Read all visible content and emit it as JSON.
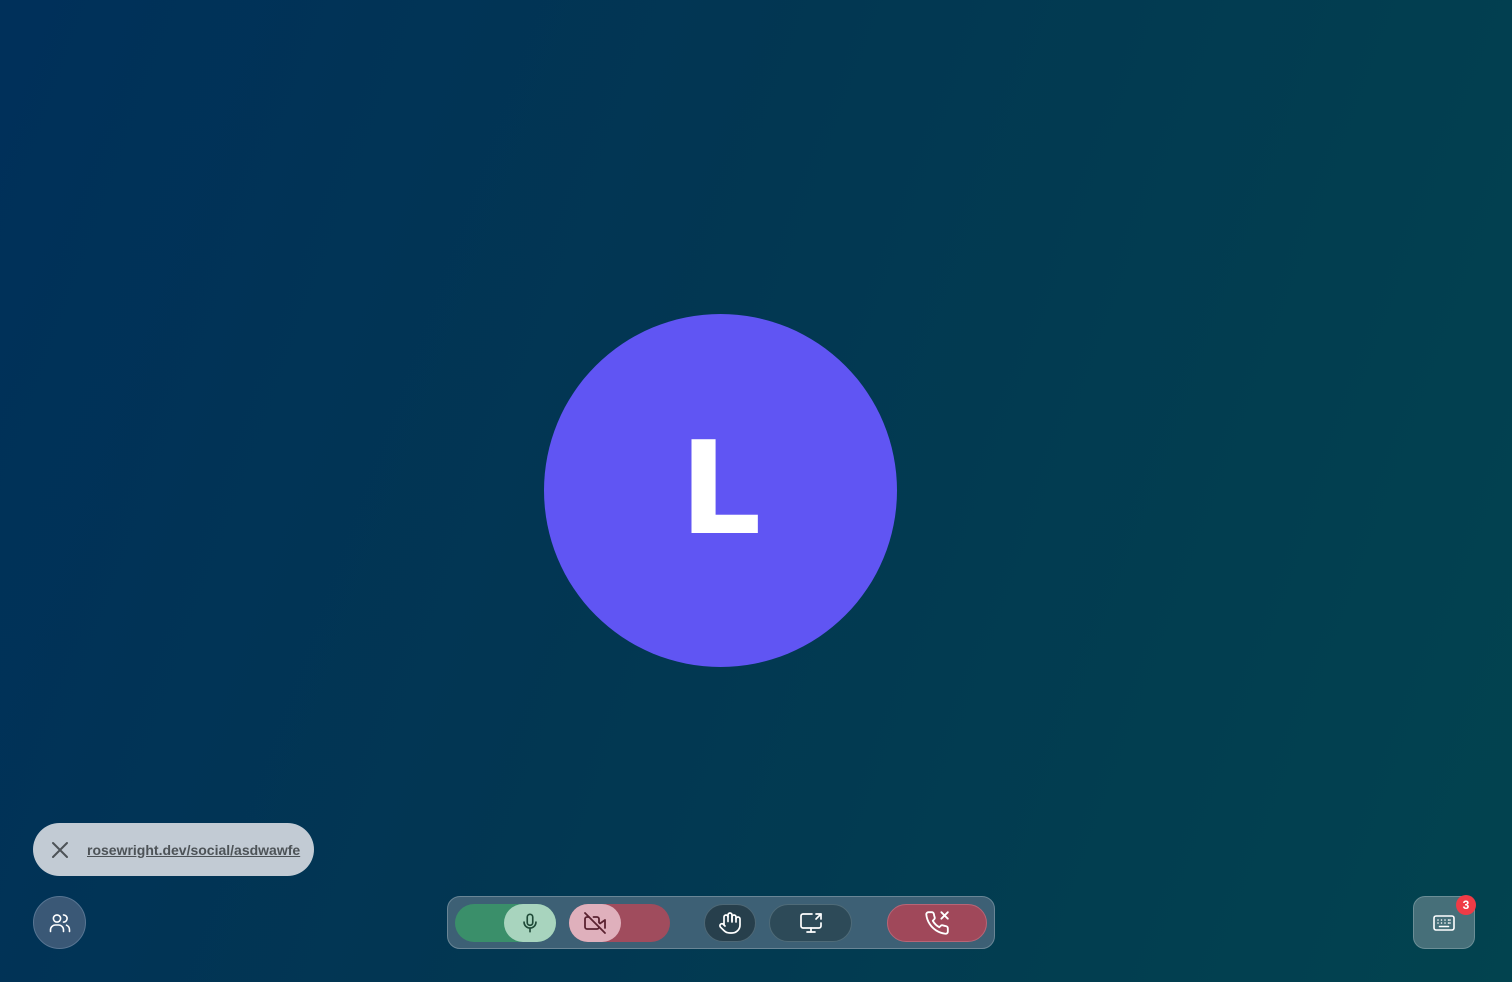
{
  "participant": {
    "avatar_initial": "L",
    "avatar_color": "#6055f3"
  },
  "share_link": {
    "url": "rosewright.dev/social/asdwawfe",
    "close_icon": "close-icon"
  },
  "people_button": {
    "icon": "users-icon"
  },
  "toolbar": {
    "microphone": {
      "icon": "microphone-icon",
      "state": "on"
    },
    "camera": {
      "icon": "camera-off-icon",
      "state": "off"
    },
    "raise_hand": {
      "icon": "hand-icon"
    },
    "screen_share": {
      "icon": "screen-share-icon"
    },
    "end_call": {
      "icon": "phone-hangup-icon"
    }
  },
  "keyboard_button": {
    "icon": "keyboard-icon",
    "badge_count": "3"
  },
  "colors": {
    "mic_on": "#3a8f6a",
    "camera_off": "#a04c5d",
    "end_call": "#a0485a",
    "badge": "#ef3b46"
  }
}
